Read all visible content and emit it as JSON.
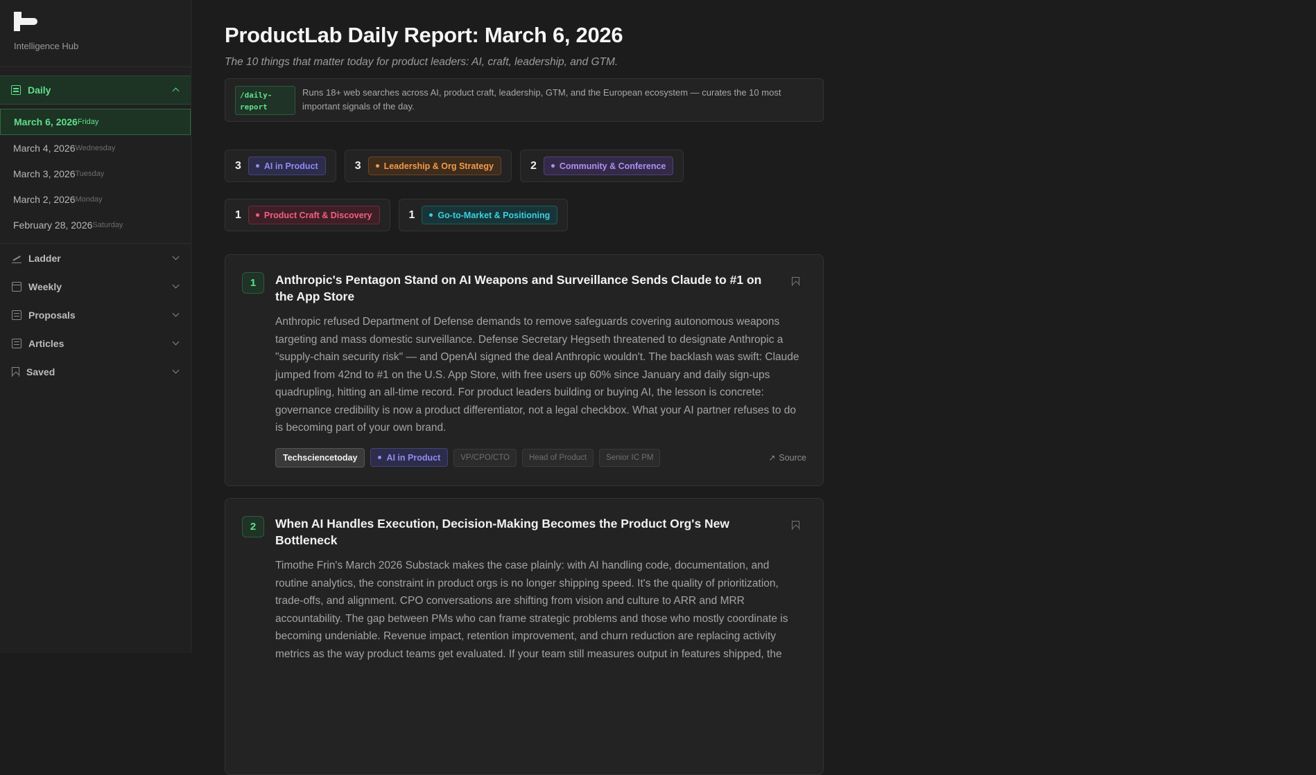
{
  "sidebar": {
    "brand_sub": "Intelligence Hub",
    "daily_label": "Daily",
    "dates": [
      {
        "date": "March 6, 2026",
        "day": "Friday"
      },
      {
        "date": "March 4, 2026",
        "day": "Wednesday"
      },
      {
        "date": "March 3, 2026",
        "day": "Tuesday"
      },
      {
        "date": "March 2, 2026",
        "day": "Monday"
      },
      {
        "date": "February 28, 2026",
        "day": "Saturday"
      }
    ],
    "nav": [
      "Ladder",
      "Weekly",
      "Proposals",
      "Articles",
      "Saved"
    ]
  },
  "header": {
    "title": "ProductLab Daily Report: March 6, 2026",
    "subtitle": "The 10 things that matter today for product leaders: AI, craft, leadership, and GTM."
  },
  "command": {
    "tag_line1": "/daily-",
    "tag_line2": "report",
    "description": "Runs 18+ web searches across AI, product craft, leadership, GTM, and the European ecosystem — curates the 10 most important signals of the day."
  },
  "categories": [
    {
      "count": "3",
      "label": "AI in Product",
      "color": "#8f8cf5",
      "bg": "#2d2c4a",
      "border": "#45437a"
    },
    {
      "count": "3",
      "label": "Leadership & Org Strategy",
      "color": "#f39a4a",
      "bg": "#3e2c1c",
      "border": "#6a4524"
    },
    {
      "count": "2",
      "label": "Community & Conference",
      "color": "#b08ff2",
      "bg": "#332a48",
      "border": "#52407a"
    },
    {
      "count": "1",
      "label": "Product Craft & Discovery",
      "color": "#f2607e",
      "bg": "#3e1f27",
      "border": "#6a2c3a"
    },
    {
      "count": "1",
      "label": "Go-to-Market & Positioning",
      "color": "#3ccfe0",
      "bg": "#173538",
      "border": "#225a60"
    }
  ],
  "articles": [
    {
      "num": "1",
      "title": "Anthropic's Pentagon Stand on AI Weapons and Surveillance Sends Claude to #1 on the App Store",
      "body": "Anthropic refused Department of Defense demands to remove safeguards covering autonomous weapons targeting and mass domestic surveillance. Defense Secretary Hegseth threatened to designate Anthropic a \"supply-chain security risk\" — and OpenAI signed the deal Anthropic wouldn't. The backlash was swift: Claude jumped from 42nd to #1 on the U.S. App Store, with free users up 60% since January and daily sign-ups quadrupling, hitting an all-time record. For product leaders building or buying AI, the lesson is concrete: governance credibility is now a product differentiator, not a legal checkbox. What your AI partner refuses to do is becoming part of your own brand.",
      "source": "Techsciencetoday",
      "category": "AI in Product",
      "audiences": [
        "VP/CPO/CTO",
        "Head of Product",
        "Senior IC PM"
      ],
      "source_link": "Source"
    },
    {
      "num": "2",
      "title": "When AI Handles Execution, Decision-Making Becomes the Product Org's New Bottleneck",
      "body": "Timothe Frin's March 2026 Substack makes the case plainly: with AI handling code, documentation, and routine analytics, the constraint in product orgs is no longer shipping speed. It's the quality of prioritization, trade-offs, and alignment. CPO conversations are shifting from vision and culture to ARR and MRR accountability. The gap between PMs who can frame strategic problems and those who mostly coordinate is becoming undeniable. Revenue impact, retention improvement, and churn reduction are replacing activity metrics as the way product teams get evaluated. If your team still measures output in features shipped, the"
    }
  ]
}
